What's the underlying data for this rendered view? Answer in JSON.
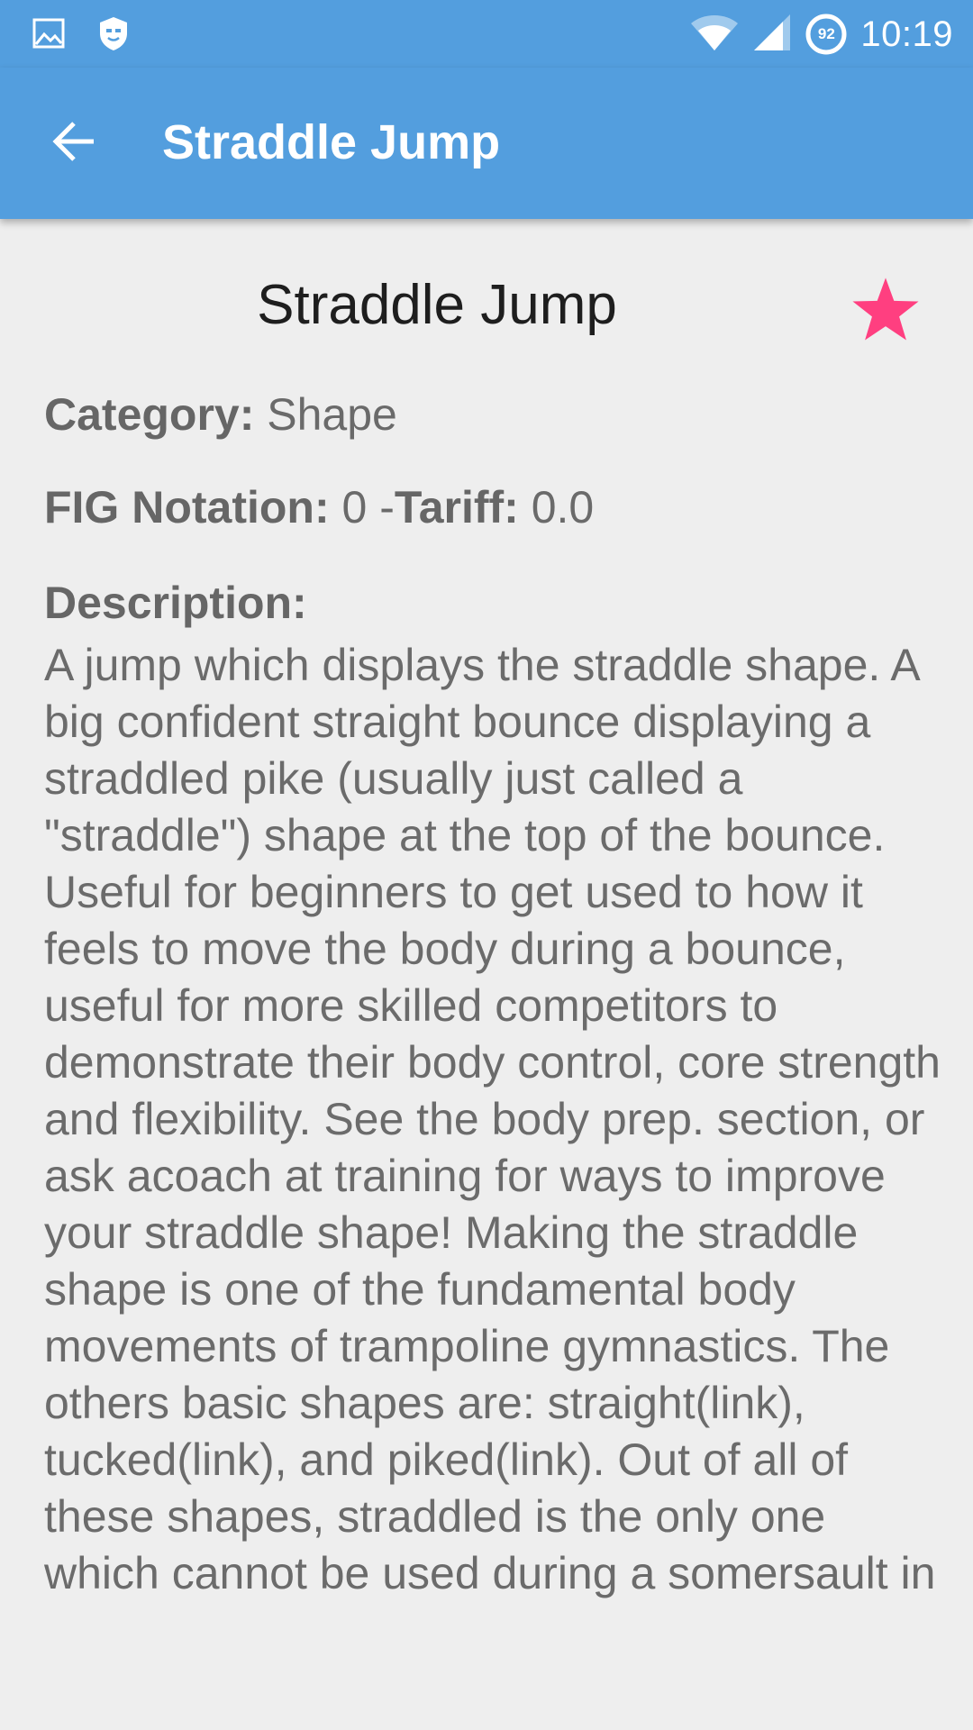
{
  "status_bar": {
    "left_icons": [
      "image-icon",
      "shield-icon"
    ],
    "right_icons": [
      "wifi-icon",
      "signal-icon",
      "battery-icon"
    ],
    "battery_level": "92",
    "time": "10:19"
  },
  "app_bar": {
    "back_icon": "arrow-left-icon",
    "title": "Straddle Jump"
  },
  "skill": {
    "title": "Straddle Jump",
    "favorite_icon": "star-icon",
    "favorite_color": "#ff3f80",
    "category_label": "Category:",
    "category_value": " Shape",
    "fig_label": "FIG Notation:",
    "fig_value": " 0 -",
    "tariff_label": "Tariff:",
    "tariff_value": " 0.0",
    "description_label": "Description:",
    "description": "A jump which displays the straddle shape. A big confident straight bounce displaying a straddled pike (usually just called a \"straddle\") shape at the top of the bounce. Useful for beginners to get used to how it feels to move the body during a bounce, useful for more skilled competitors to demonstrate their body control, core strength and flexibility. See the body prep. section, or ask acoach at training for ways to improve your straddle shape! Making the straddle shape is one of the fundamental body movements of trampoline gymnastics. The others basic shapes are: straight(link), tucked(link), and piked(link). Out of all of these shapes, straddled is the only one which cannot be used during a somersault in"
  },
  "colors": {
    "primary": "#539ede",
    "background": "#eeeeee",
    "accent": "#ff3f80"
  }
}
